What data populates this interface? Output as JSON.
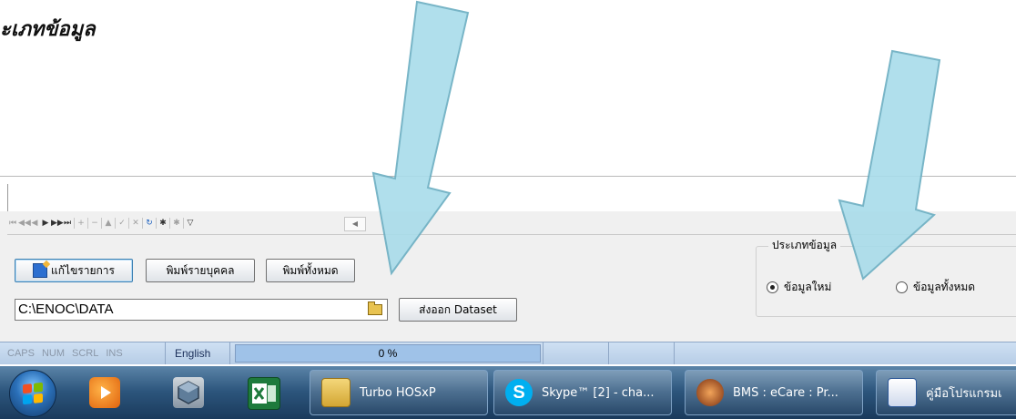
{
  "page": {
    "heading": "ะเภทข้อมูล"
  },
  "app": {
    "navigator": {
      "buttons": [
        "⏮",
        "◀◀",
        "◀",
        "▶",
        "▶▶",
        "⏭",
        "+",
        "−",
        "▲",
        "✓",
        "✕",
        "↻",
        "✱",
        "✱",
        "▽"
      ],
      "scroll_left": "◀"
    },
    "buttons": {
      "edit_label": "แก้ไขรายการ",
      "print_individual_label": "พิมพ์รายบุคคล",
      "print_all_label": "พิมพ์ทั้งหมด",
      "export_label": "ส่งออก Dataset"
    },
    "path": {
      "value": "C:\\ENOC\\DATA"
    },
    "data_type": {
      "label": "ประเภทข้อมูล",
      "options": [
        "ข้อมูลใหม่",
        "ข้อมูลทั้งหมด"
      ],
      "selected": "ข้อมูลใหม่"
    }
  },
  "statusbar": {
    "indicators": [
      "CAPS",
      "NUM",
      "SCRL",
      "INS"
    ],
    "language": "English",
    "progress_text": "0 %",
    "progress_value": 0
  },
  "taskbar": {
    "start_icon": "windows-start-icon",
    "pinned_icons": [
      "media-player-icon",
      "virtualbox-icon",
      "excel-icon"
    ],
    "tasks": [
      {
        "icon": "folder-icon",
        "label": "Turbo HOSxP"
      },
      {
        "icon": "skype-icon",
        "label": "Skype™ [2] - cha..."
      },
      {
        "icon": "bms-icon",
        "label": "BMS : eCare : Pr..."
      },
      {
        "icon": "word-icon",
        "label": "คู่มือโปรแกรมเ"
      }
    ]
  },
  "colors": {
    "arrow_fill": "#a8dcea",
    "arrow_stroke": "#6aaec2",
    "taskbar": "#2c557c",
    "statusbar": "#c6d9ee"
  }
}
